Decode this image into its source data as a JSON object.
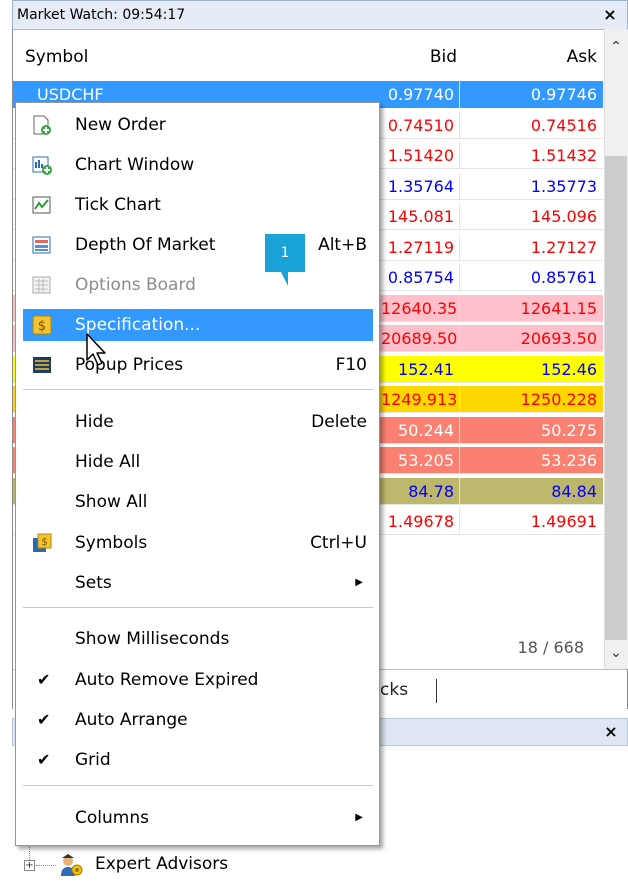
{
  "window": {
    "title": "Market Watch: 09:54:17"
  },
  "columns": {
    "symbol": "Symbol",
    "bid": "Bid",
    "ask": "Ask"
  },
  "selected_symbol": "USDCHF",
  "rows": [
    {
      "bid": "0.97740",
      "ask": "0.97746",
      "bid_color": "#ffffff",
      "ask_color": "#ffffff",
      "bg": "#3399ff"
    },
    {
      "bid": "0.74510",
      "ask": "0.74516",
      "bid_color": "#ff0000",
      "ask_color": "#ff0000",
      "bg": "#ffffff"
    },
    {
      "bid": "1.51420",
      "ask": "1.51432",
      "bid_color": "#ff0000",
      "ask_color": "#ff0000",
      "bg": "#ffffff"
    },
    {
      "bid": "1.35764",
      "ask": "1.35773",
      "bid_color": "#0000ff",
      "ask_color": "#0000ff",
      "bg": "#ffffff"
    },
    {
      "bid": "145.081",
      "ask": "145.096",
      "bid_color": "#ff0000",
      "ask_color": "#ff0000",
      "bg": "#ffffff"
    },
    {
      "bid": "1.27119",
      "ask": "1.27127",
      "bid_color": "#ff0000",
      "ask_color": "#ff0000",
      "bg": "#ffffff"
    },
    {
      "bid": "0.85754",
      "ask": "0.85761",
      "bid_color": "#0000ff",
      "ask_color": "#0000ff",
      "bg": "#ffffff"
    },
    {
      "bid": "12640.35",
      "ask": "12641.15",
      "bid_color": "#ff0000",
      "ask_color": "#ff0000",
      "bg": "#ffc0cb"
    },
    {
      "bid": "20689.50",
      "ask": "20693.50",
      "bid_color": "#ff0000",
      "ask_color": "#ff0000",
      "bg": "#ffc0cb"
    },
    {
      "bid": "152.41",
      "ask": "152.46",
      "bid_color": "#0000ff",
      "ask_color": "#0000ff",
      "bg": "#ffff00"
    },
    {
      "bid": "1249.913",
      "ask": "1250.228",
      "bid_color": "#ff0000",
      "ask_color": "#ff0000",
      "bg": "#ffd700"
    },
    {
      "bid": "50.244",
      "ask": "50.275",
      "bid_color": "#ffffff",
      "ask_color": "#ffffff",
      "bg": "#fa8072"
    },
    {
      "bid": "53.205",
      "ask": "53.236",
      "bid_color": "#ffffff",
      "ask_color": "#ffffff",
      "bg": "#fa8072"
    },
    {
      "bid": "84.78",
      "ask": "84.84",
      "bid_color": "#0000ff",
      "ask_color": "#0000ff",
      "bg": "#bdb76b"
    },
    {
      "bid": "1.49678",
      "ask": "1.49691",
      "bid_color": "#ff0000",
      "ask_color": "#ff0000",
      "bg": "#ffffff"
    }
  ],
  "symbol_count": "18 / 668",
  "tab_ticks": "cks",
  "menu": {
    "new_order": "New Order",
    "chart_window": "Chart Window",
    "tick_chart": "Tick Chart",
    "depth_of_market": "Depth Of Market",
    "depth_shortcut": "Alt+B",
    "options_board": "Options Board",
    "specification": "Specification...",
    "popup_prices": "Popup Prices",
    "popup_shortcut": "F10",
    "hide": "Hide",
    "hide_shortcut": "Delete",
    "hide_all": "Hide All",
    "show_all": "Show All",
    "symbols": "Symbols",
    "symbols_shortcut": "Ctrl+U",
    "sets": "Sets",
    "show_ms": "Show Milliseconds",
    "auto_remove": "Auto Remove Expired",
    "auto_arrange": "Auto Arrange",
    "grid": "Grid",
    "columns": "Columns",
    "check": "✔",
    "submenu_arrow": "▶"
  },
  "callout": "1",
  "navigator": {
    "expert_advisors": "Expert Advisors"
  },
  "colors": {
    "selection": "#3399ff",
    "callout": "#1aa3d6"
  }
}
